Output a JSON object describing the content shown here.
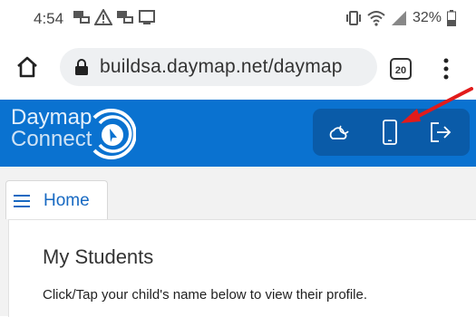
{
  "status_bar": {
    "time": "4:54",
    "battery_percent": "32%"
  },
  "browser": {
    "url": "buildsa.daymap.net/daymap",
    "tab_count": "20"
  },
  "app": {
    "logo_line1": "Daymap",
    "logo_line2": "Connect",
    "brand_color": "#0a72d0",
    "header_buttons": [
      "cloud-moon-icon",
      "mobile-phone-icon",
      "logout-icon"
    ]
  },
  "nav": {
    "home_label": "Home"
  },
  "main": {
    "title": "My Students",
    "description": "Click/Tap your child's name below to view their profile."
  },
  "annotation": {
    "arrow_color": "#e21b1b"
  }
}
